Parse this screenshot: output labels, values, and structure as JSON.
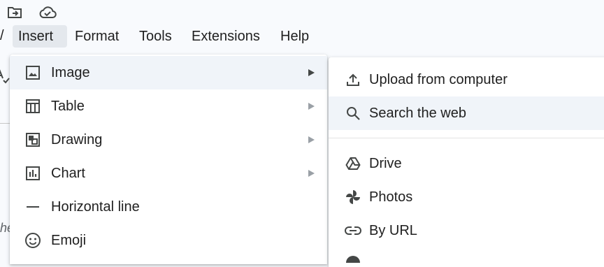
{
  "toolbar": {
    "icons": [
      "move-to-folder-icon",
      "cloud-saved-icon"
    ]
  },
  "menubar": {
    "items": [
      {
        "label": "Insert",
        "active": true
      },
      {
        "label": "Format"
      },
      {
        "label": "Tools"
      },
      {
        "label": "Extensions"
      },
      {
        "label": "Help"
      }
    ]
  },
  "edge": {
    "left_fragment": "he"
  },
  "insert_menu": {
    "items": [
      {
        "label": "Image",
        "icon": "image-icon",
        "has_submenu": true,
        "highlighted": true
      },
      {
        "label": "Table",
        "icon": "table-icon",
        "has_submenu": true
      },
      {
        "label": "Drawing",
        "icon": "drawing-icon",
        "has_submenu": true
      },
      {
        "label": "Chart",
        "icon": "chart-icon",
        "has_submenu": true
      },
      {
        "label": "Horizontal line",
        "icon": "horizontal-line-icon",
        "has_submenu": false
      },
      {
        "label": "Emoji",
        "icon": "emoji-icon",
        "has_submenu": false
      }
    ]
  },
  "image_submenu": {
    "items": [
      {
        "label": "Upload from computer",
        "icon": "upload-icon"
      },
      {
        "label": "Search the web",
        "icon": "search-icon",
        "highlighted": true
      },
      {
        "label": "Drive",
        "icon": "drive-icon"
      },
      {
        "label": "Photos",
        "icon": "photos-icon"
      },
      {
        "label": "By URL",
        "icon": "link-icon"
      }
    ]
  },
  "colors": {
    "background": "#f8fafd",
    "menu_bg": "#ffffff",
    "highlight": "#f0f4f9",
    "text": "#1f1f1f",
    "icon": "#444746"
  }
}
